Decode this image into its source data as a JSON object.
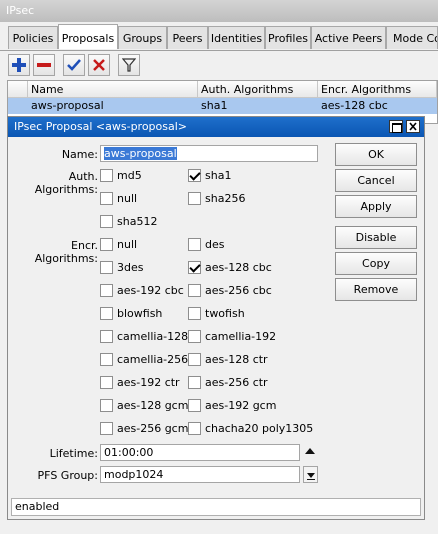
{
  "window": {
    "title": "IPsec"
  },
  "tabs": [
    "Policies",
    "Proposals",
    "Groups",
    "Peers",
    "Identities",
    "Profiles",
    "Active Peers",
    "Mode Con"
  ],
  "toolbar": {
    "add": "+",
    "remove": "−"
  },
  "table": {
    "headers": [
      "Name",
      "Auth. Algorithms",
      "Encr. Algorithms"
    ],
    "row": {
      "name": "aws-proposal",
      "auth": "sha1",
      "encr": "aes-128 cbc"
    }
  },
  "dialog": {
    "title": "IPsec Proposal <aws-proposal>",
    "name_label": "Name:",
    "name_value": "aws-proposal",
    "auth_label": "Auth. Algorithms:",
    "auth_options": [
      {
        "label": "md5",
        "checked": false
      },
      {
        "label": "sha1",
        "checked": true
      },
      {
        "label": "null",
        "checked": false
      },
      {
        "label": "sha256",
        "checked": false
      },
      {
        "label": "sha512",
        "checked": false
      }
    ],
    "encr_label": "Encr. Algorithms:",
    "encr_options": [
      {
        "label": "null",
        "checked": false
      },
      {
        "label": "des",
        "checked": false
      },
      {
        "label": "3des",
        "checked": false
      },
      {
        "label": "aes-128 cbc",
        "checked": true
      },
      {
        "label": "aes-192 cbc",
        "checked": false
      },
      {
        "label": "aes-256 cbc",
        "checked": false
      },
      {
        "label": "blowfish",
        "checked": false
      },
      {
        "label": "twofish",
        "checked": false
      },
      {
        "label": "camellia-128",
        "checked": false
      },
      {
        "label": "camellia-192",
        "checked": false
      },
      {
        "label": "camellia-256",
        "checked": false
      },
      {
        "label": "aes-128 ctr",
        "checked": false
      },
      {
        "label": "aes-192 ctr",
        "checked": false
      },
      {
        "label": "aes-256 ctr",
        "checked": false
      },
      {
        "label": "aes-128 gcm",
        "checked": false
      },
      {
        "label": "aes-192 gcm",
        "checked": false
      },
      {
        "label": "aes-256 gcm",
        "checked": false
      },
      {
        "label": "chacha20 poly1305",
        "checked": false
      }
    ],
    "lifetime_label": "Lifetime:",
    "lifetime_value": "01:00:00",
    "pfs_label": "PFS Group:",
    "pfs_value": "modp1024",
    "buttons": [
      "OK",
      "Cancel",
      "Apply",
      "Disable",
      "Copy",
      "Remove"
    ],
    "status": "enabled"
  }
}
